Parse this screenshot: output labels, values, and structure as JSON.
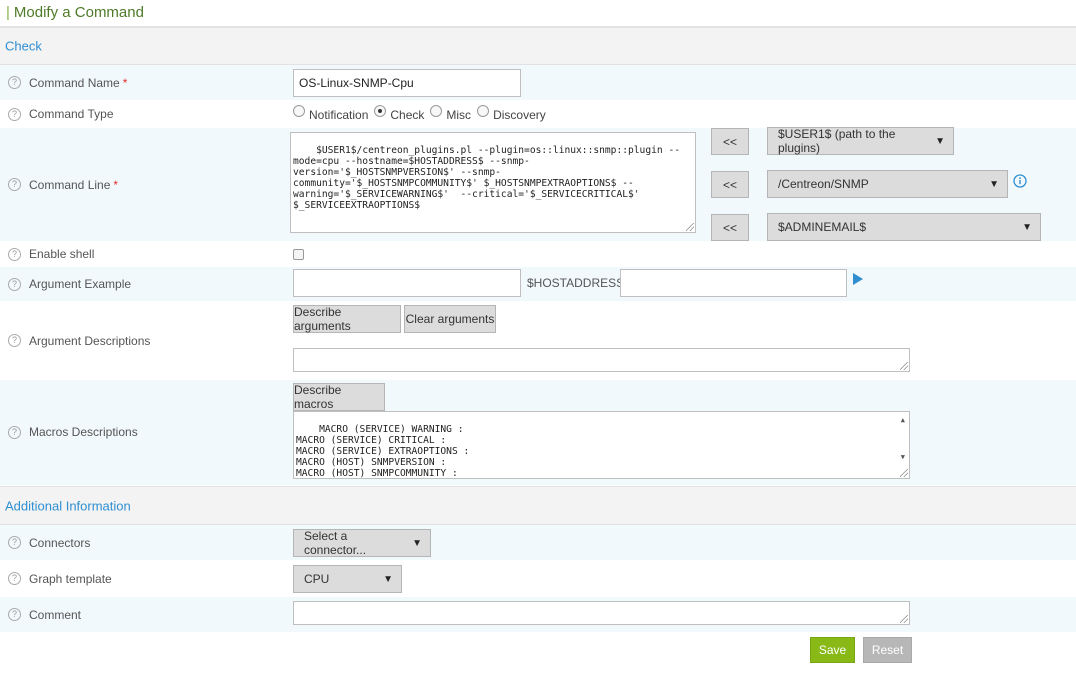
{
  "page": {
    "title": "Modify a Command"
  },
  "sections": {
    "check": "Check",
    "additional": "Additional Information"
  },
  "fields": {
    "command_name": {
      "label": "Command Name",
      "required": "*",
      "value": "OS-Linux-SNMP-Cpu"
    },
    "command_type": {
      "label": "Command Type",
      "options": [
        "Notification",
        "Check",
        "Misc",
        "Discovery"
      ],
      "selected": "Check"
    },
    "command_line": {
      "label": "Command Line",
      "required": "*",
      "value": "$USER1$/centreon_plugins.pl --plugin=os::linux::snmp::plugin --\nmode=cpu --hostname=$HOSTADDRESS$ --snmp-\nversion='$_HOSTSNMPVERSION$' --snmp-\ncommunity='$_HOSTSNMPCOMMUNITY$' $_HOSTSNMPEXTRAOPTIONS$ --\nwarning='$_SERVICEWARNING$'  --critical='$_SERVICECRITICAL$'\n$_SERVICEEXTRAOPTIONS$",
      "insert_button": "<<",
      "select_plugins": "$USER1$ (path to the plugins)",
      "select_path": "/Centreon/SNMP",
      "select_macro": "$ADMINEMAIL$"
    },
    "enable_shell": {
      "label": "Enable shell"
    },
    "argument_example": {
      "label": "Argument Example",
      "value": "",
      "host_address_label": "$HOSTADDRESS$",
      "host_address_value": ""
    },
    "argument_descriptions": {
      "label": "Argument Descriptions",
      "describe_button": "Describe arguments",
      "clear_button": "Clear arguments",
      "value": ""
    },
    "macros_descriptions": {
      "label": "Macros Descriptions",
      "describe_button": "Describe macros",
      "value": "MACRO (SERVICE) WARNING :\nMACRO (SERVICE) CRITICAL :\nMACRO (SERVICE) EXTRAOPTIONS :\nMACRO (HOST) SNMPVERSION :\nMACRO (HOST) SNMPCOMMUNITY :\nMACRO (HOST) SNMPEXTRAOPTIONS :"
    },
    "connectors": {
      "label": "Connectors",
      "value": "Select a connector..."
    },
    "graph_template": {
      "label": "Graph template",
      "value": "CPU"
    },
    "comment": {
      "label": "Comment",
      "value": ""
    }
  },
  "actions": {
    "save": "Save",
    "reset": "Reset"
  },
  "colors": {
    "accent": "#2f8fd0",
    "title": "#4f7a28",
    "save": "#88b917",
    "reset": "#b7b7b7",
    "row_alt": "#f1f9fc"
  }
}
